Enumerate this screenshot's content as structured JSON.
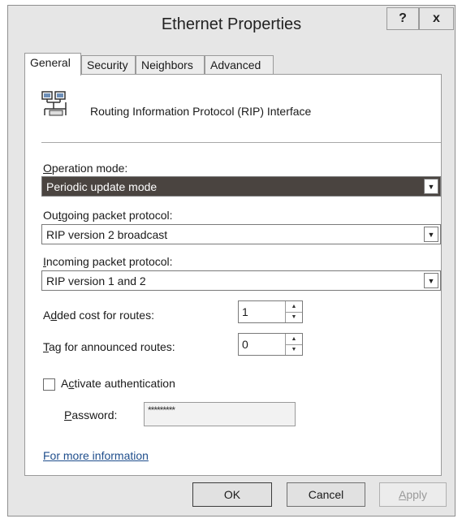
{
  "window": {
    "title": "Ethernet Properties",
    "help_label": "?",
    "close_label": "x"
  },
  "tabs": [
    {
      "label": "General",
      "active": true
    },
    {
      "label": "Security",
      "active": false
    },
    {
      "label": "Neighbors",
      "active": false
    },
    {
      "label": "Advanced",
      "active": false
    }
  ],
  "general": {
    "header_icon": "network-computers-icon",
    "header_text": "Routing Information Protocol (RIP) Interface",
    "operation_mode": {
      "label_prefix": "",
      "label_accel": "O",
      "label_rest": "peration mode:",
      "value": "Periodic update mode"
    },
    "outgoing": {
      "label_prefix": "Ou",
      "label_accel": "t",
      "label_rest": "going packet protocol:",
      "value": "RIP version 2 broadcast"
    },
    "incoming": {
      "label_prefix": "",
      "label_accel": "I",
      "label_rest": "ncoming packet protocol:",
      "value": "RIP version 1 and 2"
    },
    "added_cost": {
      "label_prefix": "A",
      "label_accel": "d",
      "label_rest": "ded cost for routes:",
      "value": "1"
    },
    "tag": {
      "label_prefix": "",
      "label_accel": "T",
      "label_rest": "ag for announced routes:",
      "value": "0"
    },
    "auth": {
      "label_prefix": "A",
      "label_accel": "c",
      "label_rest": "tivate authentication",
      "checked": false
    },
    "password": {
      "label_prefix": "",
      "label_accel": "P",
      "label_rest": "assword:",
      "value": "*********"
    },
    "more_info": "For more information"
  },
  "buttons": {
    "ok": "OK",
    "cancel": "Cancel",
    "apply_accel": "A",
    "apply_rest": "pply"
  }
}
